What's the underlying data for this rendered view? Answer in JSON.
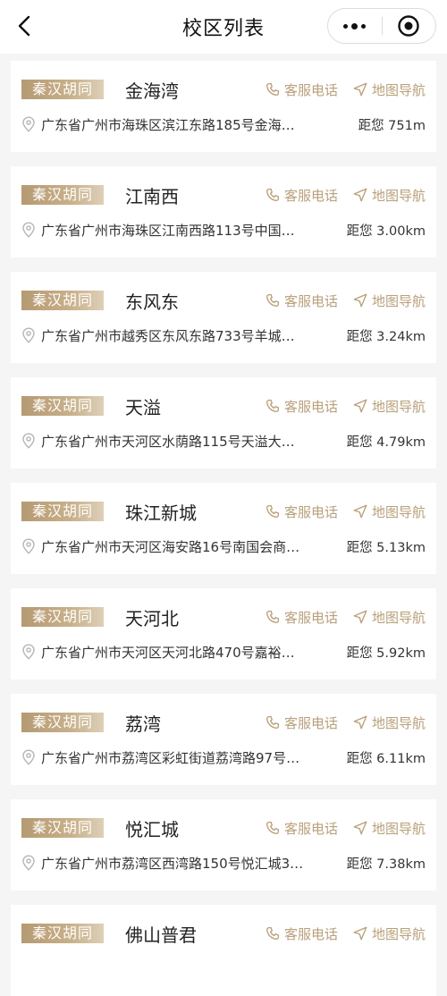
{
  "header": {
    "title": "校区列表"
  },
  "colors": {
    "accent": "#b8a07a",
    "tag_gradient_start": "#b59a72",
    "background": "#f5f5f5"
  },
  "icons": {
    "back": "chevron-left-icon",
    "more": "more-dots-icon",
    "close": "target-circle-icon",
    "phone": "phone-icon",
    "navigation": "navigation-arrow-icon",
    "location": "location-pin-icon"
  },
  "labels": {
    "call": "客服电话",
    "navigate": "地图导航"
  },
  "campuses": [
    {
      "tag": "秦汉胡同",
      "name": "金海湾",
      "address": "广东省广州市海珠区滨江东路185号金海…",
      "distance": "距您 751m"
    },
    {
      "tag": "秦汉胡同",
      "name": "江南西",
      "address": "广东省广州市海珠区江南西路113号中国…",
      "distance": "距您 3.00km"
    },
    {
      "tag": "秦汉胡同",
      "name": "东风东",
      "address": "广东省广州市越秀区东风东路733号羊城…",
      "distance": "距您 3.24km"
    },
    {
      "tag": "秦汉胡同",
      "name": "天溢",
      "address": "广东省广州市天河区水荫路115号天溢大…",
      "distance": "距您 4.79km"
    },
    {
      "tag": "秦汉胡同",
      "name": "珠江新城",
      "address": "广东省广州市天河区海安路16号南国会商…",
      "distance": "距您 5.13km"
    },
    {
      "tag": "秦汉胡同",
      "name": "天河北",
      "address": "广东省广州市天河区天河北路470号嘉裕…",
      "distance": "距您 5.92km"
    },
    {
      "tag": "秦汉胡同",
      "name": "荔湾",
      "address": "广东省广州市荔湾区彩虹街道荔湾路97号…",
      "distance": "距您 6.11km"
    },
    {
      "tag": "秦汉胡同",
      "name": "悦汇城",
      "address": "广东省广州市荔湾区西湾路150号悦汇城3…",
      "distance": "距您 7.38km"
    },
    {
      "tag": "秦汉胡同",
      "name": "佛山普君",
      "address": "",
      "distance": ""
    }
  ]
}
